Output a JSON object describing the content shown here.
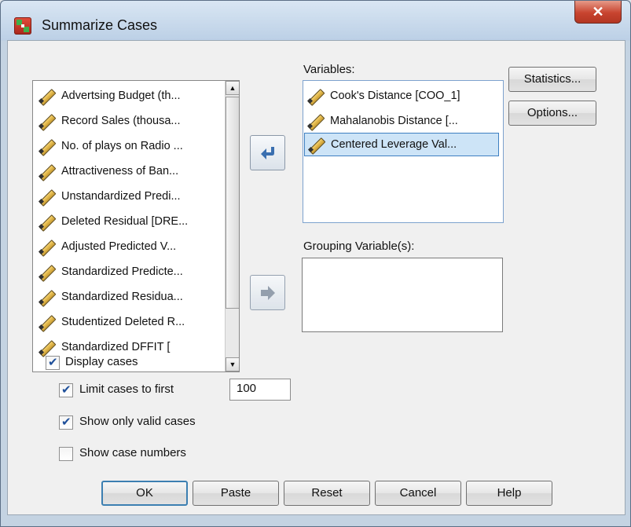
{
  "window": {
    "title": "Summarize Cases",
    "close_glyph": "✕"
  },
  "source_list": {
    "items": [
      "Advertsing Budget (th...",
      "Record Sales (thousa...",
      "No. of plays on Radio ...",
      "Attractiveness of Ban...",
      "Unstandardized Predi...",
      "Deleted Residual [DRE...",
      "Adjusted Predicted V...",
      "Standardized Predicte...",
      "Standardized Residua...",
      "Studentized Deleted R...",
      "Standardized DFFIT ["
    ],
    "scroll_up_glyph": "▲",
    "scroll_down_glyph": "▼"
  },
  "variables": {
    "label": "Variables:",
    "items": [
      "Cook's Distance [COO_1]",
      "Mahalanobis Distance [...",
      "Centered Leverage Val..."
    ],
    "selected_index": 2
  },
  "grouping": {
    "label": "Grouping Variable(s):"
  },
  "side_buttons": {
    "statistics": "Statistics...",
    "options": "Options..."
  },
  "options": {
    "display_cases": {
      "label": "Display cases",
      "checked": true
    },
    "limit_cases": {
      "label": "Limit cases to first",
      "checked": true,
      "value": "100"
    },
    "show_valid": {
      "label": "Show only valid cases",
      "checked": true
    },
    "show_case_numbers": {
      "label": "Show case numbers",
      "checked": false
    }
  },
  "buttons": {
    "ok": "OK",
    "paste": "Paste",
    "reset": "Reset",
    "cancel": "Cancel",
    "help": "Help"
  },
  "colors": {
    "accent": "#3e7fc1",
    "selection": "#cde4f7",
    "arrow": "#3a6fb0"
  }
}
